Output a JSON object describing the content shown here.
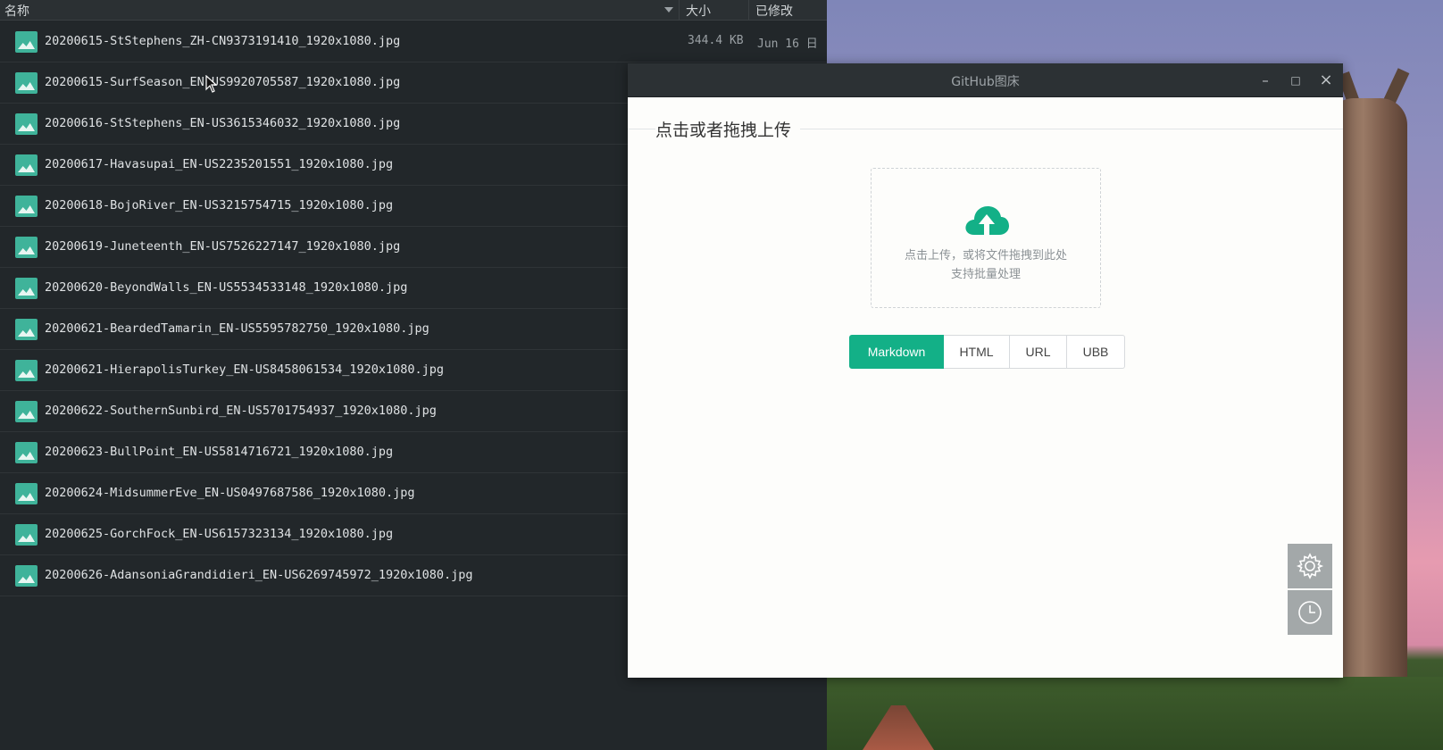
{
  "file_manager": {
    "columns": {
      "name": "名称",
      "size": "大小",
      "modified": "已修改"
    },
    "files": [
      {
        "name": "20200615-StStephens_ZH-CN9373191410_1920x1080.jpg",
        "size": "344.4 KB",
        "date": "Jun 16 日"
      },
      {
        "name": "20200615-SurfSeason_EN-US9920705587_1920x1080.jpg",
        "size": "",
        "date": ""
      },
      {
        "name": "20200616-StStephens_EN-US3615346032_1920x1080.jpg",
        "size": "",
        "date": ""
      },
      {
        "name": "20200617-Havasupai_EN-US2235201551_1920x1080.jpg",
        "size": "",
        "date": ""
      },
      {
        "name": "20200618-BojoRiver_EN-US3215754715_1920x1080.jpg",
        "size": "",
        "date": ""
      },
      {
        "name": "20200619-Juneteenth_EN-US7526227147_1920x1080.jpg",
        "size": "",
        "date": ""
      },
      {
        "name": "20200620-BeyondWalls_EN-US5534533148_1920x1080.jpg",
        "size": "",
        "date": ""
      },
      {
        "name": "20200621-BeardedTamarin_EN-US5595782750_1920x1080.jpg",
        "size": "",
        "date": ""
      },
      {
        "name": "20200621-HierapolisTurkey_EN-US8458061534_1920x1080.jpg",
        "size": "",
        "date": ""
      },
      {
        "name": "20200622-SouthernSunbird_EN-US5701754937_1920x1080.jpg",
        "size": "",
        "date": ""
      },
      {
        "name": "20200623-BullPoint_EN-US5814716721_1920x1080.jpg",
        "size": "",
        "date": ""
      },
      {
        "name": "20200624-MidsummerEve_EN-US0497687586_1920x1080.jpg",
        "size": "",
        "date": ""
      },
      {
        "name": "20200625-GorchFock_EN-US6157323134_1920x1080.jpg",
        "size": "",
        "date": ""
      },
      {
        "name": "20200626-AdansoniaGrandidieri_EN-US6269745972_1920x1080.jpg",
        "size": "",
        "date": ""
      }
    ],
    "file_icon": "image-file-icon"
  },
  "app_window": {
    "title": "GitHub图床",
    "controls": {
      "minimize": "–",
      "maximize": "□",
      "close": "×"
    },
    "section_title": "点击或者拖拽上传",
    "upload": {
      "icon": "cloud-upload-icon",
      "line1": "点击上传，或将文件拖拽到此处",
      "line2": "支持批量处理"
    },
    "formats": [
      "Markdown",
      "HTML",
      "URL",
      "UBB"
    ],
    "selected_format": "Markdown",
    "side_buttons": {
      "settings_icon": "gear-icon",
      "history_icon": "clock-icon"
    }
  },
  "colors": {
    "accent": "#13b087",
    "file_icon": "#3fb39a",
    "file_manager_bg": "#22272a",
    "titlebar_bg": "#2c3134",
    "side_button_bg": "#a3a8a9"
  }
}
